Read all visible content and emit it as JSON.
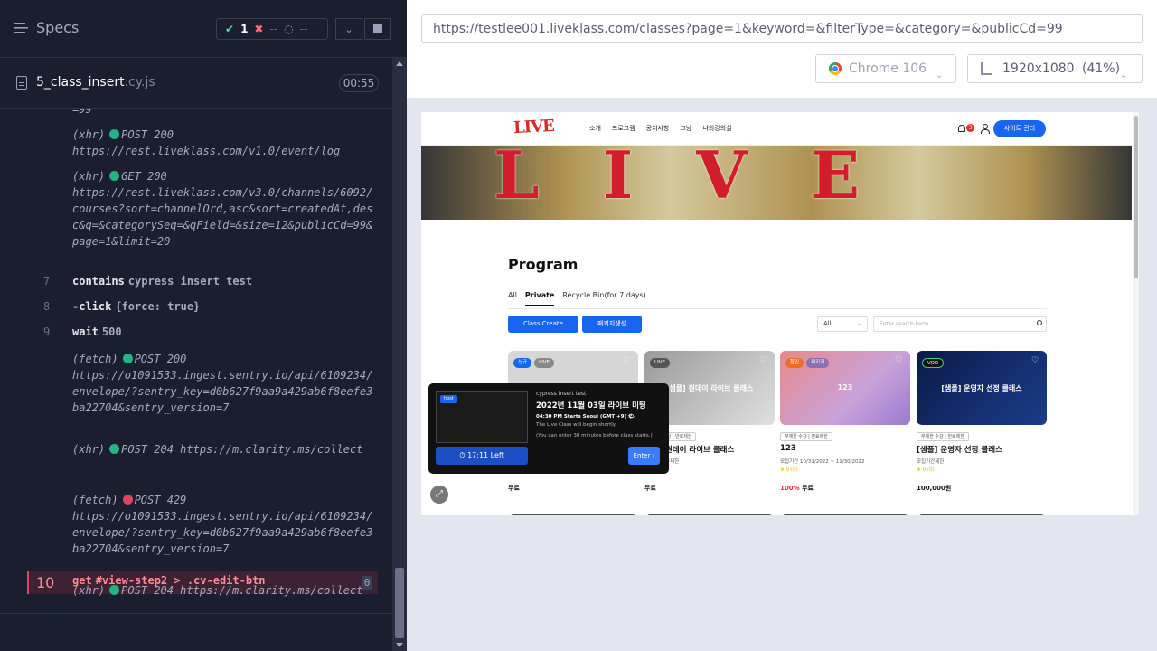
{
  "left_panel": {
    "title": "Specs",
    "stats": {
      "passed": "1",
      "failed": "--",
      "pending": "--"
    },
    "file": {
      "name": "5_class_insert",
      "ext": ".cy.js",
      "duration": "00:55"
    },
    "log": {
      "frag_top": "=99",
      "xhr1": {
        "type": "(xhr)",
        "method": "POST 200",
        "url": "https://rest.liveklass.com/v1.0/event/log"
      },
      "xhr2": {
        "type": "(xhr)",
        "method": "GET 200",
        "url": "https://rest.liveklass.com/v3.0/channels/6092/courses?sort=channelOrd,asc&sort=createdAt,desc&q=&categorySeq=&qField=&size=12&publicCd=99&page=1&limit=20"
      },
      "cmd7": {
        "num": "7",
        "name": "contains",
        "msg": "cypress insert test"
      },
      "cmd8": {
        "num": "8",
        "name": "-click",
        "msg": "{force: true}"
      },
      "cmd9": {
        "num": "9",
        "name": "wait",
        "msg": "500"
      },
      "fetch1": {
        "type": "(fetch)",
        "method": "POST 200",
        "url": "https://o1091533.ingest.sentry.io/api/6109234/envelope/?sentry_key=d0b627f9aa9a429ab6f8eefe3ba22704&sentry_version=7"
      },
      "xhr3": {
        "type": "(xhr)",
        "method": "POST 204",
        "url": "https://m.clarity.ms/collect"
      },
      "cmd10": {
        "num": "10",
        "name": "get",
        "msg": "#view-step2 > .cv-edit-btn",
        "count": "0"
      },
      "fetch2": {
        "type": "(fetch)",
        "method": "POST 429",
        "url": "https://o1091533.ingest.sentry.io/api/6109234/envelope/?sentry_key=d0b627f9aa9a429ab6f8eefe3ba22704&sentry_version=7"
      },
      "xhr4": {
        "type": "(xhr)",
        "method": "POST 204",
        "url": "https://m.clarity.ms/collect"
      }
    }
  },
  "browser_bar": {
    "url": "https://testlee001.liveklass.com/classes?page=1&keyword=&filterType=&category=&publicCd=99",
    "browser": "Chrome 106",
    "viewport": "1920x1080",
    "zoom": "(41%)"
  },
  "aut": {
    "logo": "LIVE",
    "nav": [
      "소개",
      "프로그램",
      "공지사항",
      "그냥",
      "나의강의실"
    ],
    "notif_count": "3",
    "site_admin": "사이트 관리",
    "hero_letters": [
      "L",
      "I",
      "V",
      "E"
    ],
    "page_title": "Program",
    "tabs": [
      "All",
      "Private",
      "Recycle Bin(for 7 days)"
    ],
    "create_btn": "Class Create",
    "package_btn": "패키지생성",
    "filter_select": "All",
    "search_placeholder": "Enter search term",
    "cards": [
      {
        "badges": [
          "신규",
          "LIVE"
        ],
        "title": "",
        "price": "무료",
        "rating": ""
      },
      {
        "badges": [
          "LIVE"
        ],
        "center": "[샘플] 원데이 라이브 클래스",
        "title": "원데이 라이브 클래스",
        "tag": "수강 | 만료제한",
        "meta": "무제한",
        "price": "무료"
      },
      {
        "badges": [
          "할인",
          "패키지"
        ],
        "center": "123",
        "title": "123",
        "tag": "무제한 수강 | 만료제한",
        "meta": "모집기간 10/31/2022 ~ 11/30/2022",
        "rating": "★ 0 (0)",
        "discount": "100%",
        "price": "무료"
      },
      {
        "badges": [
          "VOD"
        ],
        "center": "[샘플] 운영자 선정 클래스",
        "title": "[샘플] 운영자 선정 클래스",
        "tag": "무제한 수강 | 만료제한",
        "meta": "모집기간제한",
        "rating": "★ 0 (0)",
        "price": "100,000원"
      }
    ],
    "popup": {
      "host": "host",
      "small": "cypress insert test",
      "title": "2022년 11월 03일 라이브 미팅",
      "time": "04:30 PM Starts Seoul (GMT +9) 🌤",
      "line1": "The Live Class will begin shortly.",
      "line2": "(You can enter 30 minutes before class starts.)",
      "timer": "⏱ 17:11 Left",
      "enter": "Enter ›"
    }
  }
}
